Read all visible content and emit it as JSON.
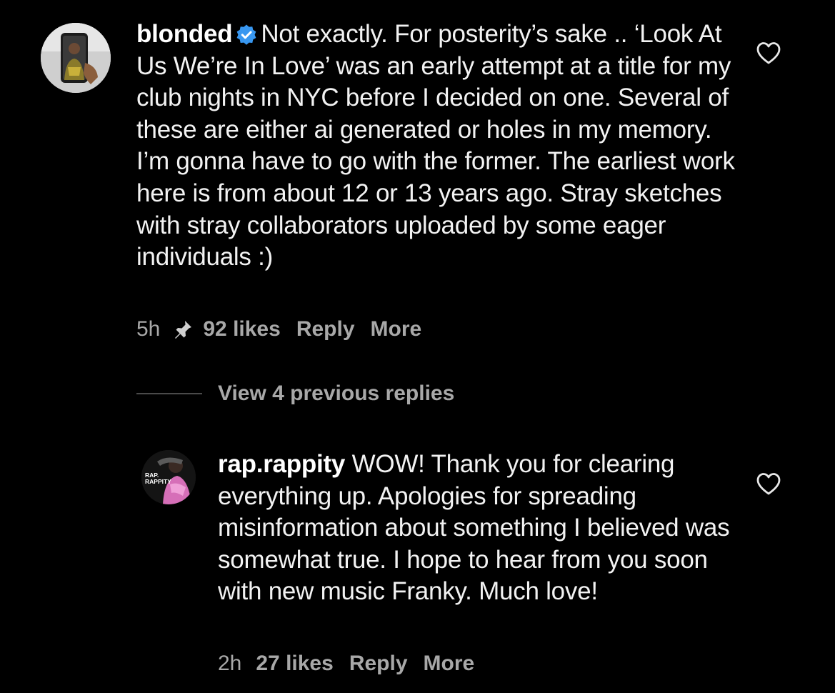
{
  "comment": {
    "username": "blonded",
    "verified": true,
    "text": "Not exactly. For posterity’s sake .. ‘Look At Us We’re In Love’ was an early attempt at a title for my club nights in NYC before I decided on one. Several of these are either ai generated or holes in my memory. I’m gonna have to go with the former. The earliest work here is from about 12 or 13 years ago. Stray sketches with stray collaborators uploaded by some eager individuals :)",
    "time": "5h",
    "likes": "92 likes",
    "reply_label": "Reply",
    "more_label": "More",
    "pinned": true
  },
  "view_replies_label": "View 4 previous replies",
  "reply": {
    "username": "rap.rappity",
    "avatar_text": "RAP. RAPPITY",
    "text": "WOW! Thank you for clearing everything up. Apologies for spreading misinformation about something I believed was somewhat true. I hope to hear from you soon with new music Franky. Much love!",
    "time": "2h",
    "likes": "27 likes",
    "reply_label": "Reply",
    "more_label": "More"
  },
  "colors": {
    "background": "#000000",
    "text": "#f2f2f2",
    "meta": "#a8a8a8",
    "verified": "#3897f0"
  },
  "icons": [
    "verified-badge-icon",
    "heart-icon",
    "pin-icon"
  ]
}
